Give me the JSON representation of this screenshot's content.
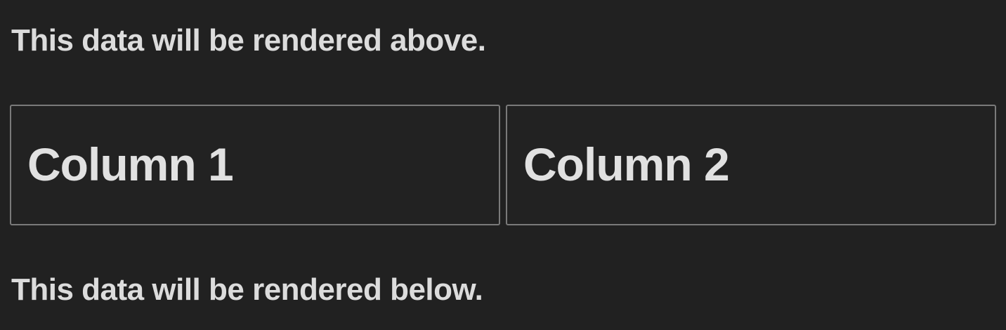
{
  "text_above": "This data will be rendered above.",
  "columns": [
    {
      "heading": "Column 1"
    },
    {
      "heading": "Column 2"
    }
  ],
  "text_below": "This data will be rendered below.",
  "colors": {
    "background": "#212121",
    "text": "#dcdcdc",
    "border": "#7a7a7a"
  }
}
